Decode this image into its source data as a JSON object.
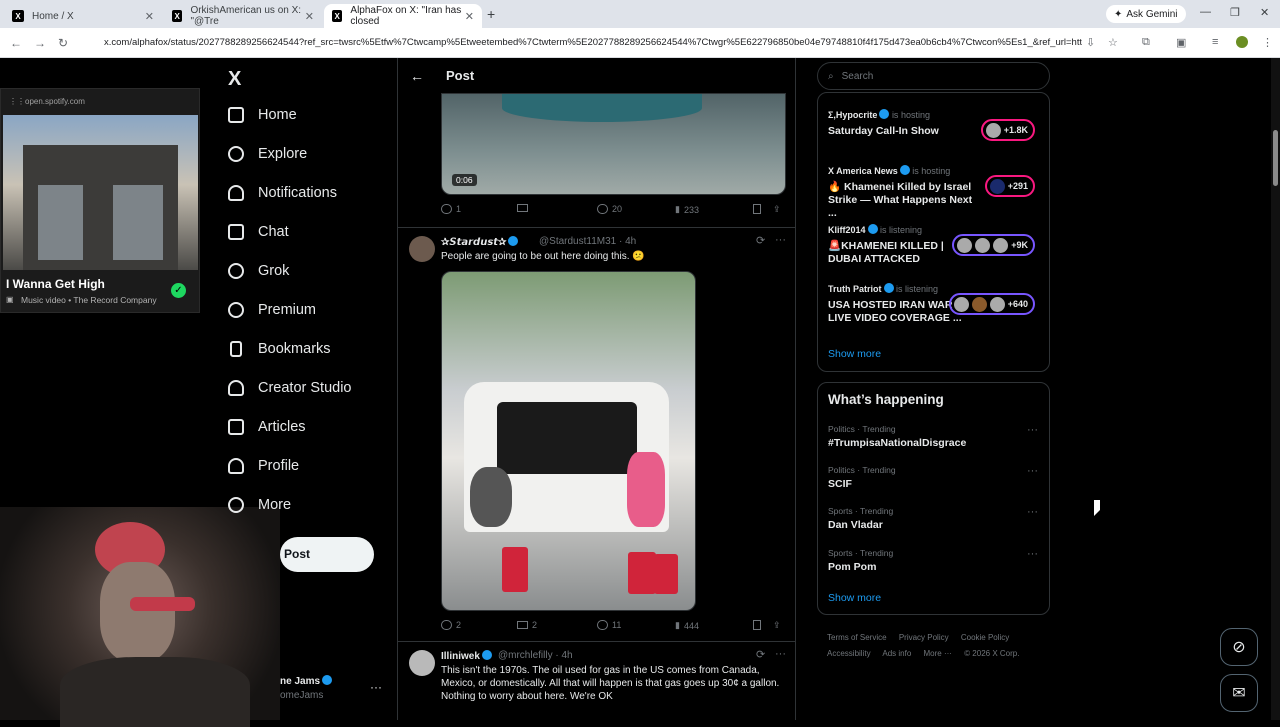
{
  "browser": {
    "tabs": [
      {
        "label": "Home / X"
      },
      {
        "label": "OrkishAmerican us on X: \"@Tre"
      },
      {
        "label": "AlphaFox on X: \"Iran has closed"
      }
    ],
    "ask_gemini": "Ask Gemini",
    "url": "x.com/alphafox/status/2027788289256624544?ref_src=twsrc%5Etfw%7Ctwcamp%5Etweetembed%7Ctwterm%5E2027788289256624544%7Ctwgr%5E622796850be04e79748810f4f175d473ea0b6cb4%7Ctwcon%5Es1_&ref_url=http%3A..."
  },
  "spotify": {
    "host": "open.spotify.com",
    "title": "I Wanna Get High",
    "subtitle": "Music video • The Record Company"
  },
  "nav": {
    "logo": "X",
    "items": [
      {
        "label": "Home",
        "icon": "home-icon"
      },
      {
        "label": "Explore",
        "icon": "search-icon"
      },
      {
        "label": "Notifications",
        "icon": "bell-icon"
      },
      {
        "label": "Chat",
        "icon": "mail-icon"
      },
      {
        "label": "Grok",
        "icon": "grok-icon"
      },
      {
        "label": "Premium",
        "icon": "premium-icon"
      },
      {
        "label": "Bookmarks",
        "icon": "bookmark-icon"
      },
      {
        "label": "Creator Studio",
        "icon": "creator-icon"
      },
      {
        "label": "Articles",
        "icon": "articles-icon"
      },
      {
        "label": "Profile",
        "icon": "profile-icon"
      },
      {
        "label": "More",
        "icon": "more-icon"
      }
    ],
    "post_button": "Post",
    "account_name": "ne Jams",
    "account_handle": "omeJams"
  },
  "timeline": {
    "header_title": "Post",
    "video_duration": "0:06",
    "post0_actions": {
      "replies": "1",
      "reposts": "",
      "likes": "20",
      "views": "233"
    },
    "post1": {
      "name": "✰𝙎𝙩𝙖𝙧𝙙𝙪𝙨𝙩✰",
      "handle": "@Stardust11M31 · 4h",
      "text": "People are going to be out here doing this. 😕",
      "replies": "2",
      "reposts": "2",
      "likes": "11",
      "views": "444"
    },
    "post2": {
      "name": "Illiniwek",
      "handle": "@mrchlefilly · 4h",
      "text": "This isn't the 1970s.  The oil used for gas in the US comes from Canada, Mexico, or domestically.  All that will happen is that gas goes up 30¢ a gallon. Nothing to worry about here.  We're OK"
    }
  },
  "sidebar": {
    "search_placeholder": "Search",
    "spaces": [
      {
        "host": "Σ,Hypocrite",
        "status": "is hosting",
        "title": "Saturday Call-In Show",
        "count": "+1.8K"
      },
      {
        "host": "X America News",
        "status": "is hosting",
        "title": "🔥 Khamenei Killed by Israel Strike — What Happens Next ...",
        "count": "+291"
      },
      {
        "host": "Kliff2014",
        "status": "is listening",
        "title": "🚨KHAMENEI KILLED | DUBAI ATTACKED",
        "count": "+9K"
      },
      {
        "host": "Truth Patriot",
        "status": "is listening",
        "title": "USA HOSTED IRAN WAR LIVE VIDEO COVERAGE ...",
        "count": "+640"
      }
    ],
    "spaces_show_more": "Show more",
    "whats_happening_title": "What’s happening",
    "trends": [
      {
        "context": "Politics · Trending",
        "topic": "#TrumpisaNationalDisgrace"
      },
      {
        "context": "Politics · Trending",
        "topic": "SCIF"
      },
      {
        "context": "Sports · Trending",
        "topic": "Dan Vladar"
      },
      {
        "context": "Sports · Trending",
        "topic": "Pom Pom"
      }
    ],
    "trends_show_more": "Show more",
    "footer": {
      "terms": "Terms of Service",
      "privacy": "Privacy Policy",
      "cookie": "Cookie Policy",
      "accessibility": "Accessibility",
      "ads": "Ads info",
      "more": "More ···",
      "copyright": "© 2026 X Corp."
    }
  },
  "colors": {
    "accent": "#1d9bf0",
    "live": "#f91880",
    "listening": "#7856ff",
    "spotify_green": "#1ed760"
  }
}
